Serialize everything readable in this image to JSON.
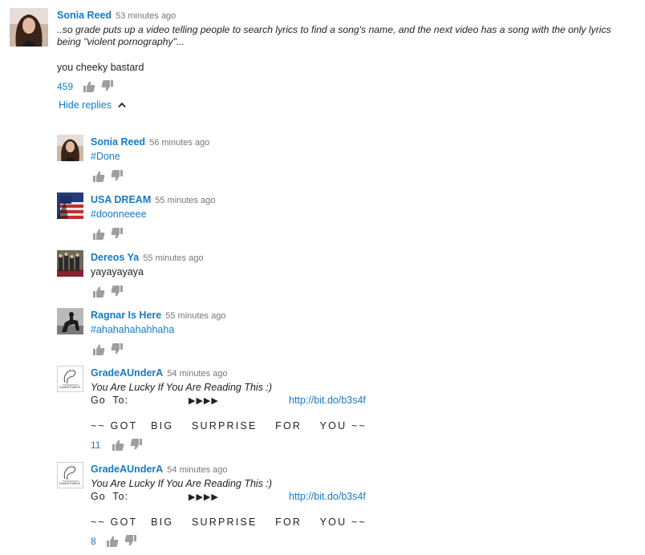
{
  "top_comment": {
    "author": "Sonia Reed",
    "time": "53 minutes ago",
    "quote_line1": "..so grade puts up a video telling people to search lyrics to find a song's name, and the next video has a song with the only lyrics",
    "quote_line2": "being \"violent pornography\"...",
    "body": "you cheeky bastard",
    "likes": "459",
    "hide_replies": "Hide replies"
  },
  "replies": [
    {
      "author": "Sonia Reed",
      "time": "56 minutes ago",
      "text": "#Done"
    },
    {
      "author": "USA DREAM",
      "time": "55 minutes ago",
      "text": "#doonneeee"
    },
    {
      "author": "Dereos Ya",
      "time": "55 minutes ago",
      "text": "yayayayaya"
    },
    {
      "author": "Ragnar Is Here",
      "time": "55 minutes ago",
      "text": "#ahahahahahhaha"
    },
    {
      "author": "GradeAUnderA",
      "time": "54 minutes ago",
      "line1": "You Are Lucky If You Are Reading This  :)",
      "go_to": "Go  To:",
      "arrows": "▶▶▶▶",
      "link": "http://bit.do/b3s4f",
      "surprise": "~~ GOT   BIG    SURPRISE    FOR    YOU ~~",
      "likes": "11"
    },
    {
      "author": "GradeAUnderA",
      "time": "54 minutes ago",
      "line1": "You Are Lucky If You Are Reading This  :)",
      "go_to": "Go  To:",
      "arrows": "▶▶▶▶",
      "link": "http://bit.do/b3s4f",
      "surprise": "~~ GOT   BIG    SURPRISE    FOR    YOU ~~",
      "likes": "8"
    }
  ],
  "avatar_logo_text": "GradeA UnderA"
}
